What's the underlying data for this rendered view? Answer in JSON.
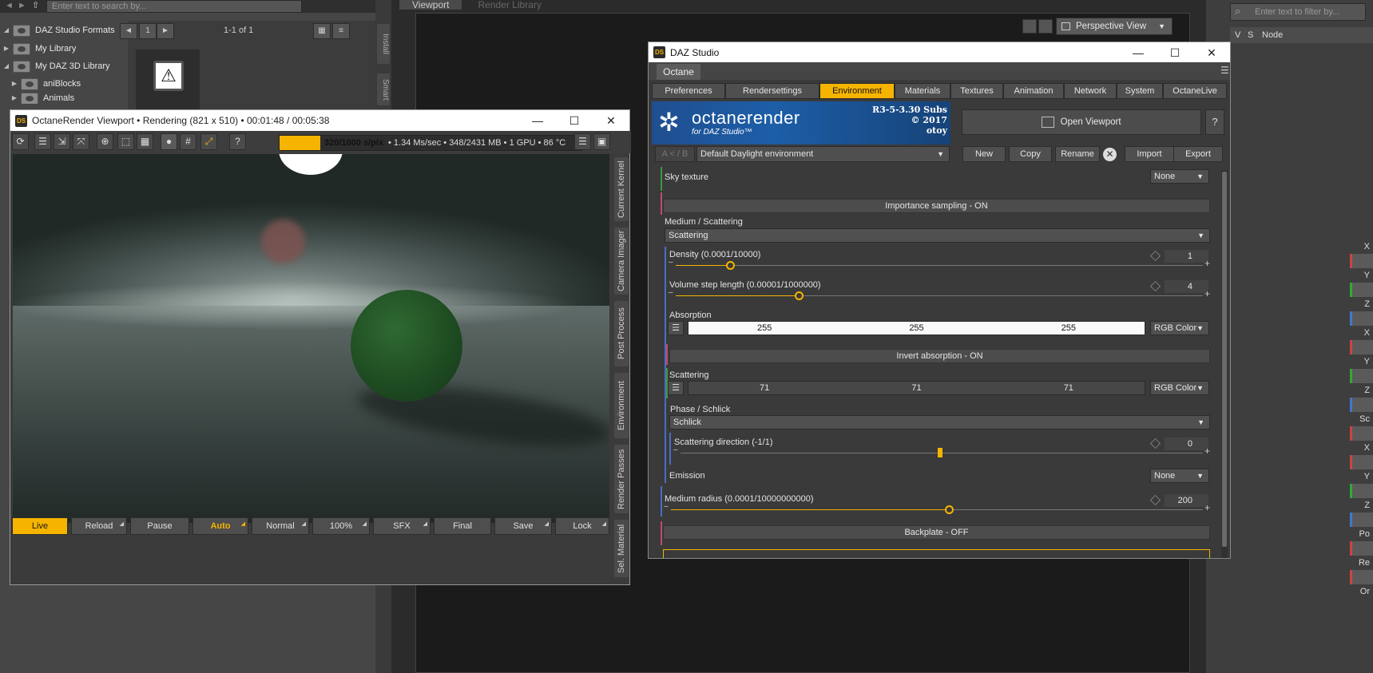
{
  "background": {
    "search_placeholder": "Enter text to search by...",
    "tree_items": [
      {
        "label": "DAZ Studio Formats",
        "expanded": true
      },
      {
        "label": "My Library",
        "expanded": false
      },
      {
        "label": "My DAZ 3D Library",
        "expanded": true
      },
      {
        "label": "aniBlocks",
        "expanded": false
      },
      {
        "label": "Animals",
        "expanded": false
      }
    ],
    "page_number": "1",
    "page_range": "1-1 of 1",
    "side_tabs": [
      "Install",
      "Smart"
    ],
    "viewport_tabs": [
      "Viewport",
      "Render Library"
    ],
    "perspective_label": "Perspective View",
    "filter_placeholder": "Enter text to filter by...",
    "node_label": "Node",
    "node_v": "V",
    "node_s": "S",
    "axis_labels": [
      "X",
      "Y",
      "Z",
      "X",
      "Y",
      "Z",
      "X",
      "Y",
      "Z"
    ],
    "right_labels": [
      "Sc",
      "Po",
      "Re",
      "Or"
    ]
  },
  "octane_viewport": {
    "title": "OctaneRender Viewport • Rendering (821 x 510) • 00:01:48 / 00:05:38",
    "progress_fraction": 0.32,
    "progress_main": "320/1000 s/pix",
    "progress_rest": "• 1.34 Ms/sec • 348/2431 MB • 1 GPU • 86 °C",
    "side_tabs": [
      "Current Kernel",
      "Camera Imager",
      "Post Process",
      "Environment",
      "Render Passes",
      "Sel. Material"
    ],
    "bottom_buttons": [
      "Live",
      "Reload",
      "Pause",
      "Auto",
      "Normal",
      "100%",
      "SFX",
      "Final",
      "Save",
      "Lock"
    ]
  },
  "daz_dialog": {
    "title": "DAZ Studio",
    "sub_tab": "Octane",
    "tabs": [
      "Preferences",
      "Rendersettings",
      "Environment",
      "Materials",
      "Textures",
      "Animation",
      "Network",
      "System",
      "OctaneLive"
    ],
    "active_tab": "Environment",
    "banner": {
      "product": "octanerender",
      "subtitle": "for DAZ Studio™",
      "version": "R3-5-3.30 Subs",
      "year": "© 2017",
      "vendor": "otoy"
    },
    "open_viewport": "Open Viewport",
    "help": "?",
    "ab_label": "A < / B",
    "environment_select": "Default Daylight environment",
    "env_buttons": [
      "New",
      "Copy",
      "Rename",
      "Import",
      "Export"
    ],
    "params": {
      "sky_texture_label": "Sky texture",
      "sky_texture_value": "None",
      "importance_sampling": "Importance sampling - ON",
      "medium_label": "Medium / Scattering",
      "medium_value": "Scattering",
      "density_label": "Density (0.0001/10000)",
      "density_value": "1",
      "volume_step_label": "Volume step length (0.00001/1000000)",
      "volume_step_value": "4",
      "absorption_label": "Absorption",
      "absorption_rgb": [
        "255",
        "255",
        "255"
      ],
      "absorption_mode": "RGB Color",
      "invert_absorption": "Invert absorption - ON",
      "scattering_label": "Scattering",
      "scattering_rgb": [
        "71",
        "71",
        "71"
      ],
      "scattering_mode": "RGB Color",
      "phase_label": "Phase / Schlick",
      "phase_value": "Schlick",
      "scatter_dir_label": "Scattering direction (-1/1)",
      "scatter_dir_value": "0",
      "emission_label": "Emission",
      "emission_value": "None",
      "medium_radius_label": "Medium radius (0.0001/10000000000)",
      "medium_radius_value": "200",
      "backplate": "Backplate - OFF"
    }
  },
  "colors": {
    "accent": "#f5b400",
    "banner_blue": "#1d5ea8"
  }
}
